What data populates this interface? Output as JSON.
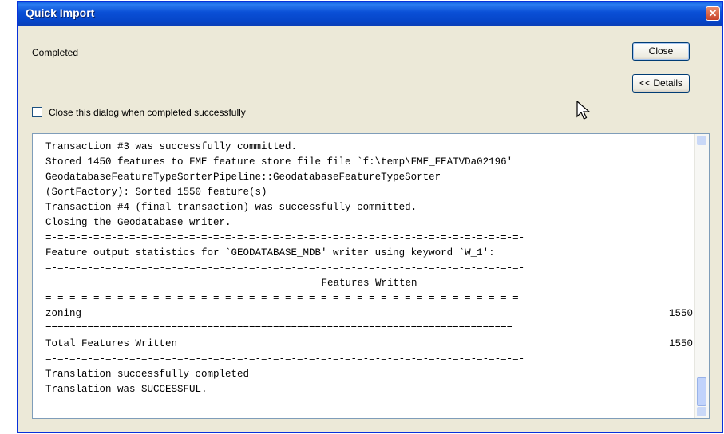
{
  "window": {
    "title": "Quick Import",
    "close_glyph": "✕"
  },
  "status": "Completed",
  "buttons": {
    "close": "Close",
    "details": "<< Details"
  },
  "checkbox": {
    "label": "Close this dialog when completed successfully",
    "checked": false
  },
  "log": {
    "lines": [
      "Transaction #3 was successfully committed.",
      "Stored 1450 features to FME feature store file file `f:\\temp\\FME_FEATVDa02196'",
      "GeodatabaseFeatureTypeSorterPipeline::GeodatabaseFeatureTypeSorter",
      "(SortFactory): Sorted 1550 feature(s)",
      "Transaction #4 (final transaction) was successfully committed.",
      "Closing the Geodatabase writer.",
      "=-=-=-=-=-=-=-=-=-=-=-=-=-=-=-=-=-=-=-=-=-=-=-=-=-=-=-=-=-=-=-=-=-=-=-=-=-=-=-=-",
      "Feature output statistics for `GEODATABASE_MDB' writer using keyword `W_1':",
      "=-=-=-=-=-=-=-=-=-=-=-=-=-=-=-=-=-=-=-=-=-=-=-=-=-=-=-=-=-=-=-=-=-=-=-=-=-=-=-=-",
      "Features Written",
      "=-=-=-=-=-=-=-=-=-=-=-=-=-=-=-=-=-=-=-=-=-=-=-=-=-=-=-=-=-=-=-=-=-=-=-=-=-=-=-=-",
      "zoning",
      "==============================================================================",
      "Total Features Written",
      "=-=-=-=-=-=-=-=-=-=-=-=-=-=-=-=-=-=-=-=-=-=-=-=-=-=-=-=-=-=-=-=-=-=-=-=-=-=-=-=-",
      "Translation successfully completed",
      "Translation was SUCCESSFUL."
    ],
    "zoning_count": "1550",
    "total_count": "1550"
  },
  "icons": {
    "cursor": "mouse-pointer-icon",
    "scroll_up": "scroll-up-arrow-icon",
    "scroll_down": "scroll-down-arrow-icon"
  },
  "colors": {
    "titlebar": "#0a4fd6",
    "dialog_bg": "#ece9d8",
    "close_button": "#c7432b"
  }
}
